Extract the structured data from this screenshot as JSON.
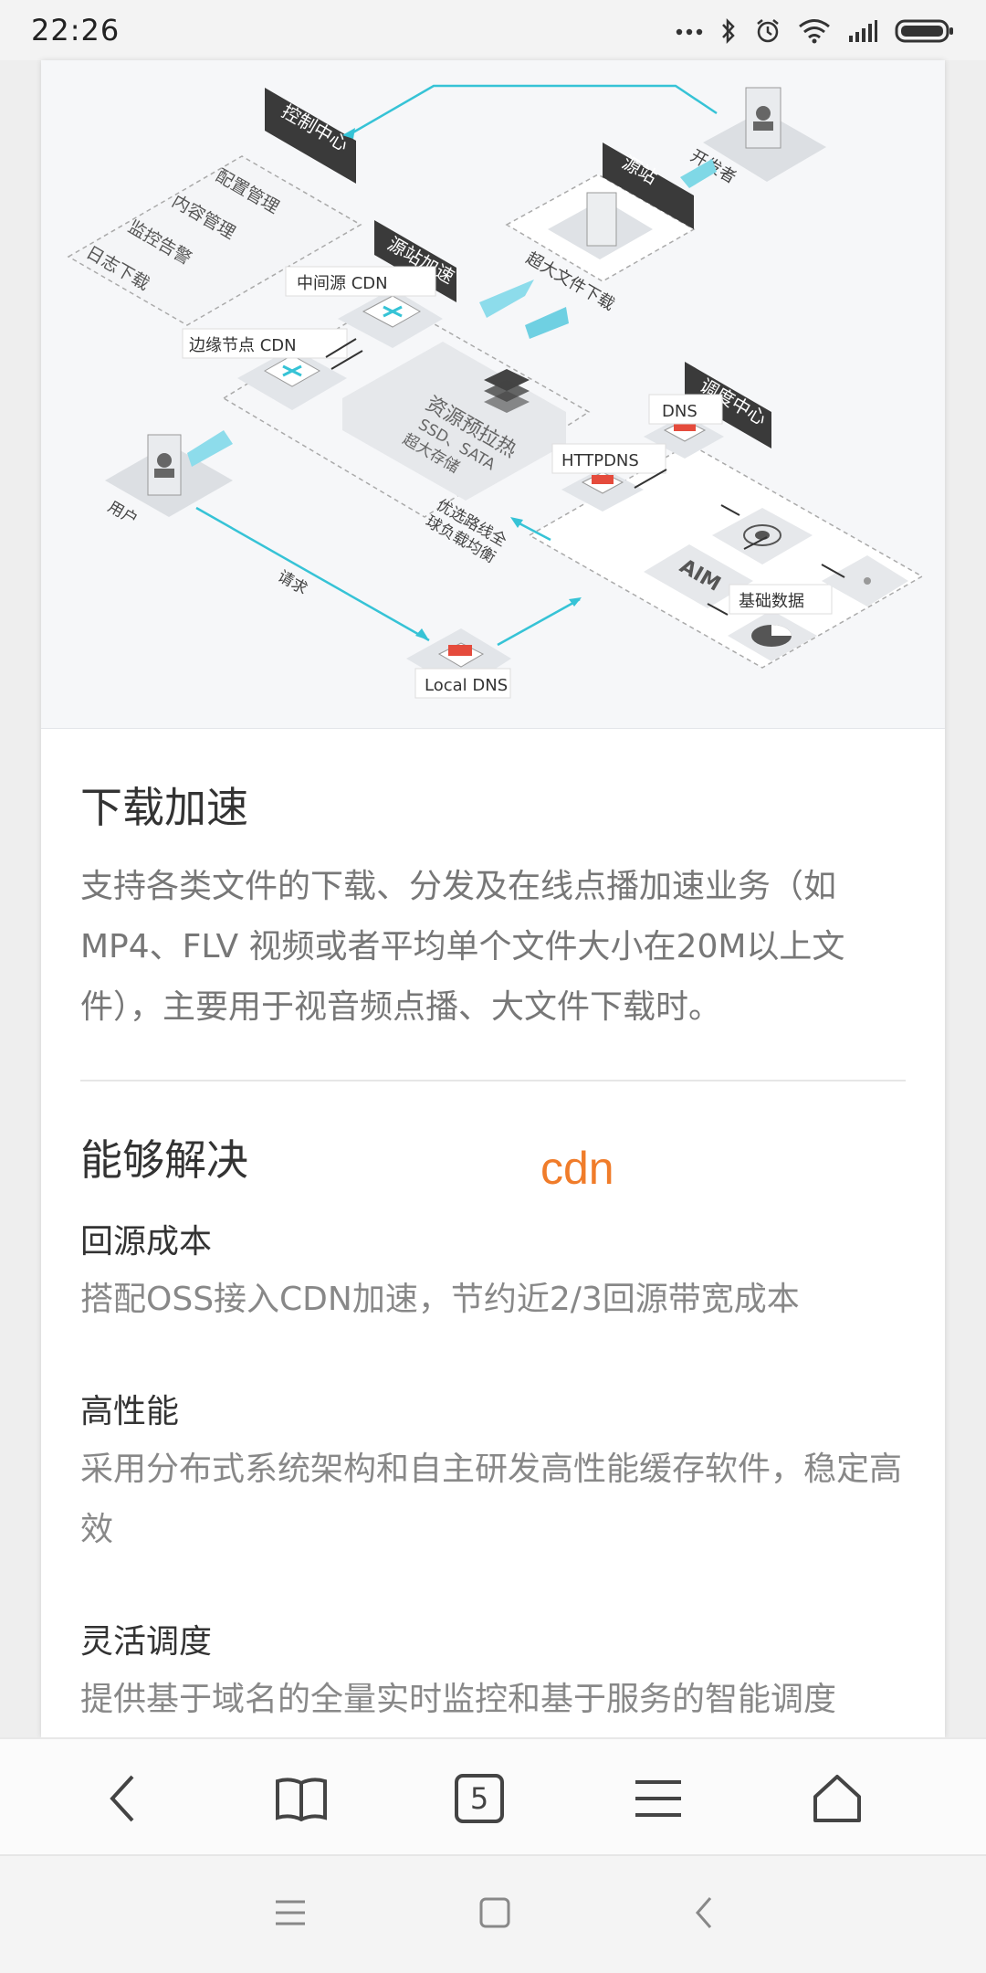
{
  "status_bar": {
    "time": "22:26",
    "icons": [
      "more-dots-icon",
      "bluetooth-icon",
      "alarm-icon",
      "wifi-icon",
      "signal-icon",
      "battery-icon"
    ]
  },
  "diagram": {
    "labels": {
      "control_center": "控制中心",
      "config_mgmt": "配置管理",
      "content_mgmt": "内容管理",
      "monitor_alert": "监控告警",
      "log_download": "日志下载",
      "origin_accel": "源站加速",
      "mid_cdn": "中间源 CDN",
      "edge_cdn": "边缘节点 CDN",
      "resource_preheat": "资源预拉热",
      "storage_types": "SSD、SATA",
      "large_storage": "超大存储",
      "origin": "源站",
      "large_file_download": "超大文件下载",
      "developer": "开发者",
      "scheduling_center": "调度中心",
      "dns": "DNS",
      "httpdns": "HTTPDNS",
      "aim": "AIM",
      "basic_data": "基础数据",
      "user": "用户",
      "request": "请求",
      "optimal_route": "优选路线全",
      "load_balance": "球负载均衡",
      "local_dns": "Local DNS"
    }
  },
  "article": {
    "title": "下载加速",
    "description": "支持各类文件的下载、分发及在线点播加速业务（如MP4、FLV 视频或者平均单个文件大小在20M以上文件），主要用于视音频点播、大文件下载时。",
    "solve_title": "能够解决",
    "items": [
      {
        "title": "回源成本",
        "text": "搭配OSS接入CDN加速，节约近2/3回源带宽成本"
      },
      {
        "title": "高性能",
        "text": "采用分布式系统架构和自主研发高性能缓存软件，稳定高效"
      },
      {
        "title": "灵活调度",
        "text": "提供基于域名的全量实时监控和基于服务的智能调度"
      }
    ]
  },
  "overlay_text": "cdn",
  "toolbar": {
    "tabs_count": "5",
    "buttons": [
      "back-icon",
      "bookmarks-icon",
      "tabs-icon",
      "menu-icon",
      "home-icon"
    ]
  },
  "colors": {
    "accent_cyan": "#36c3d6",
    "label_dark": "#3a3a3a",
    "overlay_orange": "#f07c2a"
  }
}
